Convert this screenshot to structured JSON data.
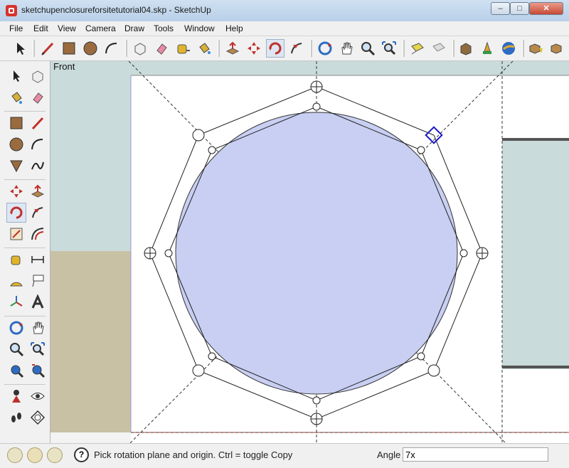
{
  "window": {
    "title": "sketchupenclosureforsitetutorial04.skp - SketchUp",
    "min": "–",
    "max": "□",
    "close": "✕"
  },
  "menu": [
    {
      "label": "File"
    },
    {
      "label": "Edit"
    },
    {
      "label": "View"
    },
    {
      "label": "Camera"
    },
    {
      "label": "Draw"
    },
    {
      "label": "Tools"
    },
    {
      "label": "Window"
    },
    {
      "label": "Help"
    }
  ],
  "toolbar": {
    "icons": [
      "select-icon",
      "line-icon",
      "rectangle-icon",
      "circle-icon",
      "arc-icon",
      "make-component-icon",
      "eraser-icon",
      "tape-measure-icon",
      "paint-bucket-icon",
      "push-pull-icon",
      "move-icon",
      "rotate-icon",
      "follow-me-icon",
      "orbit-icon",
      "pan-icon",
      "zoom-icon",
      "zoom-extents-icon",
      "previous-view-icon",
      "next-view-icon",
      "3d-warehouse-icon",
      "share-model-icon",
      "google-earth-icon",
      "get-models-icon",
      "components-icon"
    ]
  },
  "palette": {
    "icons": [
      "select-icon",
      "make-component-icon",
      "paint-bucket-icon",
      "eraser-icon",
      "rectangle-icon",
      "line-icon",
      "circle-icon",
      "arc-icon",
      "polygon-icon",
      "freehand-icon",
      "move-icon",
      "push-pull-icon",
      "rotate-icon",
      "follow-me-icon",
      "scale-icon",
      "offset-icon",
      "tape-measure-icon",
      "dimension-icon",
      "protractor-icon",
      "text-icon",
      "axes-icon",
      "3d-text-icon",
      "orbit-icon",
      "pan-icon",
      "zoom-icon",
      "zoom-window-icon",
      "zoom-extents-icon",
      "previous-icon",
      "position-camera-icon",
      "look-around-icon",
      "walk-icon",
      "section-plane-icon"
    ]
  },
  "viewport": {
    "scene_label": "Front"
  },
  "status": {
    "hint": "Pick rotation plane and origin.  Ctrl = toggle Copy",
    "measure_label": "Angle",
    "measure_value": "7x"
  },
  "colors": {
    "face": "#c8cff2",
    "axis_rotation": "#1b1bc8",
    "ground": "#c8c1a4",
    "sky": "#c9dbda",
    "red_axis": "#c0392b"
  }
}
